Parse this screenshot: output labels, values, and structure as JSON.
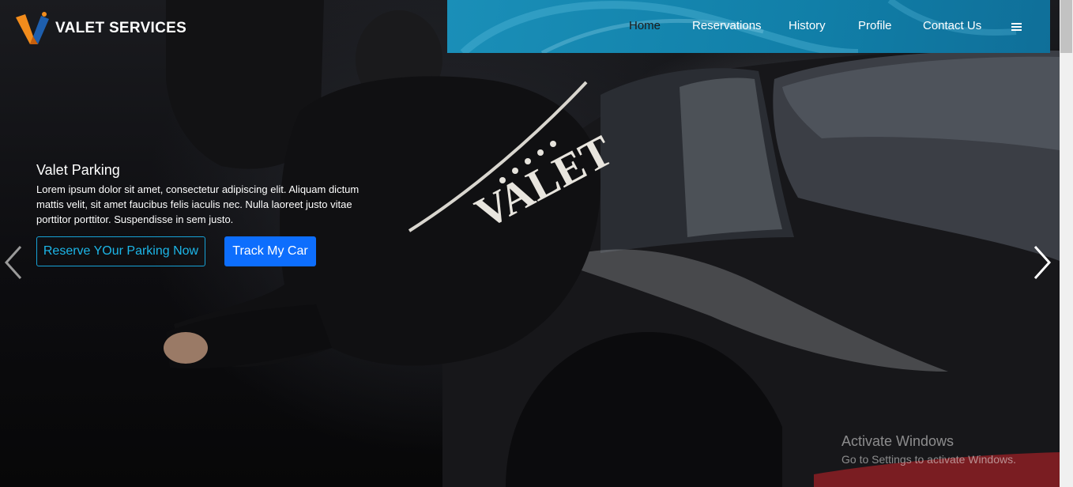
{
  "brand": {
    "name": "VALET SERVICES",
    "accent": "#f28c1c",
    "logo_blue": "#1e5fae"
  },
  "nav": {
    "items": [
      {
        "label": "Home",
        "active": true
      },
      {
        "label": "Reservations",
        "active": false
      },
      {
        "label": "History",
        "active": false
      },
      {
        "label": "Profile",
        "active": false
      },
      {
        "label": "Contact Us",
        "active": false
      }
    ],
    "menu_icon": "hamburger-icon",
    "background": "#1487b4"
  },
  "hero": {
    "jacket_text": "VALET",
    "title": "Valet Parking",
    "text": "Lorem ipsum dolor sit amet, consectetur adipiscing elit. Aliquam dictum mattis velit, sit amet faucibus felis iaculis nec. Nulla laoreet justo vitae porttitor porttitor. Suspendisse in sem justo.",
    "reserve_label": "Reserve YOur Parking Now",
    "track_label": "Track My Car",
    "prev_icon": "chevron-left-icon",
    "next_icon": "chevron-right-icon"
  },
  "watermark": {
    "title": "Activate Windows",
    "subtitle": "Go to Settings to activate Windows."
  }
}
